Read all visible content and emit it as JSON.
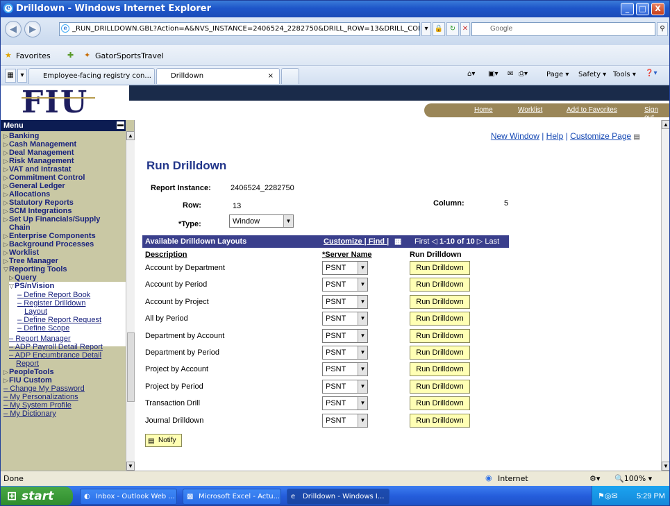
{
  "window": {
    "title": "Drilldown - Windows Internet Explorer"
  },
  "browser": {
    "url": "_RUN_DRILLDOWN.GBL?Action=A&NVS_INSTANCE=2406524_2282750&DRILL_ROW=13&DRILL_COL",
    "search_placeholder": "Google",
    "favorites_label": "Favorites",
    "fav_link": "GatorSportsTravel",
    "tabs": [
      {
        "label": "Employee-facing registry con..."
      },
      {
        "label": "Drilldown"
      }
    ],
    "tools": {
      "page": "Page",
      "safety": "Safety",
      "tools": "Tools"
    }
  },
  "banner": {
    "logo": "FIU",
    "links": [
      "Home",
      "Worklist",
      "Add to Favorites",
      "Sign out"
    ]
  },
  "menu": {
    "header": "Menu",
    "items": [
      {
        "label": "Banking"
      },
      {
        "label": "Cash Management"
      },
      {
        "label": "Deal Management"
      },
      {
        "label": "Risk Management"
      },
      {
        "label": "VAT and Intrastat"
      },
      {
        "label": "Commitment Control"
      },
      {
        "label": "General Ledger"
      },
      {
        "label": "Allocations"
      },
      {
        "label": "Statutory Reports"
      },
      {
        "label": "SCM Integrations"
      },
      {
        "label": "Set Up Financials/Supply"
      },
      {
        "label": "Chain"
      },
      {
        "label": "Enterprise Components"
      },
      {
        "label": "Background Processes"
      },
      {
        "label": "Worklist"
      },
      {
        "label": "Tree Manager"
      },
      {
        "label": "Reporting Tools"
      },
      {
        "label": "Query"
      },
      {
        "label": "PS/nVision"
      },
      {
        "label": "Define Report Book"
      },
      {
        "label": "Register Drilldown"
      },
      {
        "label": "Layout"
      },
      {
        "label": "Define Report Request"
      },
      {
        "label": "Define Scope"
      },
      {
        "label": "Report Manager"
      },
      {
        "label": "ADP Payroll Detail Report"
      },
      {
        "label": "ADP Encumbrance Detail"
      },
      {
        "label": "Report"
      },
      {
        "label": "PeopleTools"
      },
      {
        "label": "FIU Custom"
      },
      {
        "label": "Change My Password"
      },
      {
        "label": "My Personalizations"
      },
      {
        "label": "My System Profile"
      },
      {
        "label": "My Dictionary"
      }
    ]
  },
  "main": {
    "links": {
      "new_window": "New Window",
      "help": "Help",
      "customize": "Customize Page"
    },
    "title": "Run Drilldown",
    "report_instance_label": "Report Instance:",
    "report_instance": "2406524_2282750",
    "row_label": "Row:",
    "row": "13",
    "column_label": "Column:",
    "column": "5",
    "type_label": "*Type:",
    "type": "Window",
    "grid": {
      "title": "Available Drilldown Layouts",
      "customize": "Customize | Find |",
      "nav": "First",
      "range": "1-10 of 10",
      "last": "Last",
      "col_desc": "Description",
      "col_server": "*Server Name",
      "col_run": "Run Drilldown",
      "rows": [
        {
          "desc": "Account by Department",
          "server": "PSNT",
          "btn": "Run Drilldown"
        },
        {
          "desc": "Account by Period",
          "server": "PSNT",
          "btn": "Run Drilldown"
        },
        {
          "desc": "Account by Project",
          "server": "PSNT",
          "btn": "Run Drilldown"
        },
        {
          "desc": "All by Period",
          "server": "PSNT",
          "btn": "Run Drilldown"
        },
        {
          "desc": "Department by Account",
          "server": "PSNT",
          "btn": "Run Drilldown"
        },
        {
          "desc": "Department by Period",
          "server": "PSNT",
          "btn": "Run Drilldown"
        },
        {
          "desc": "Project by Account",
          "server": "PSNT",
          "btn": "Run Drilldown"
        },
        {
          "desc": "Project by Period",
          "server": "PSNT",
          "btn": "Run Drilldown"
        },
        {
          "desc": "Transaction Drill",
          "server": "PSNT",
          "btn": "Run Drilldown"
        },
        {
          "desc": "Journal Drilldown",
          "server": "PSNT",
          "btn": "Run Drilldown"
        }
      ]
    },
    "notify": "Notify"
  },
  "status": {
    "text": "Done",
    "zone": "Internet",
    "zoom": "100%"
  },
  "taskbar": {
    "start": "start",
    "tasks": [
      "Inbox - Outlook Web ...",
      "Microsoft Excel - Actu...",
      "Drilldown - Windows I..."
    ],
    "clock": "5:29 PM"
  }
}
